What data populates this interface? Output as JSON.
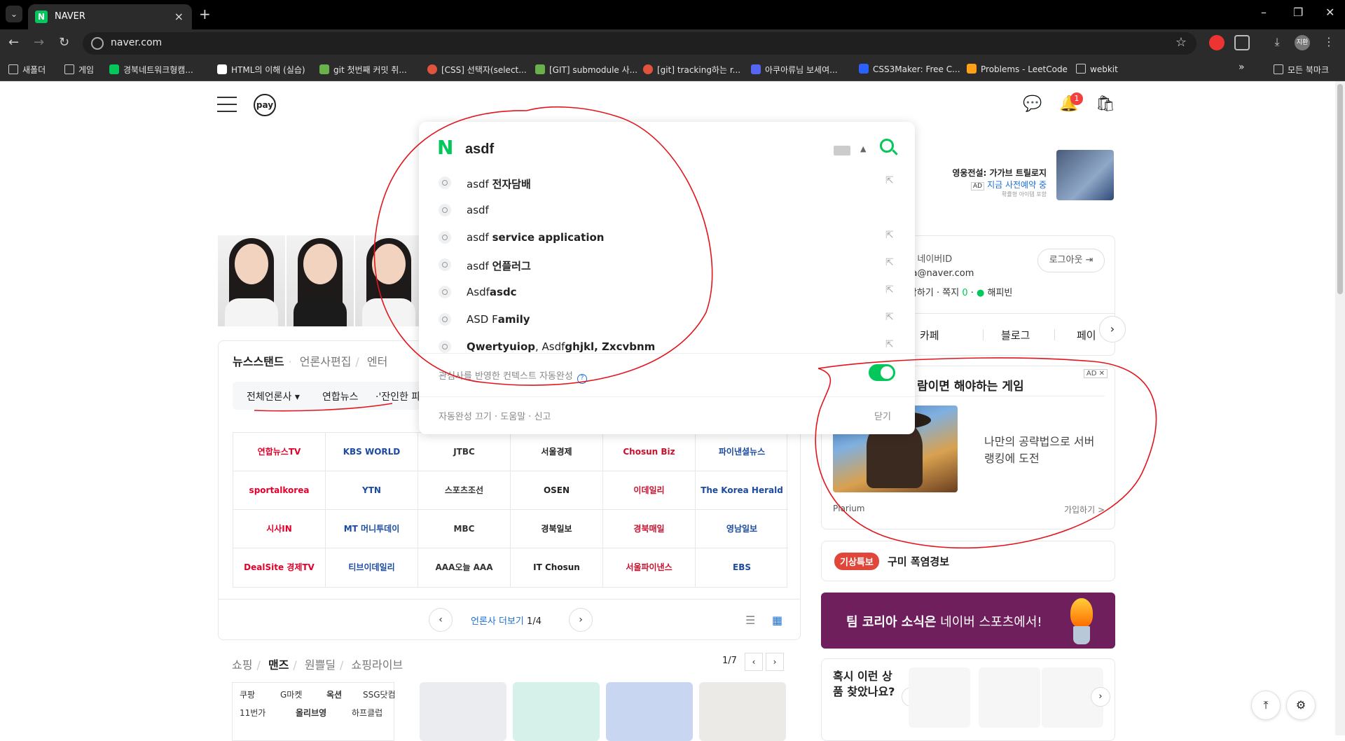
{
  "browser": {
    "tab_title": "NAVER",
    "tab_favicon": "N",
    "url": "naver.com",
    "profile": "지환",
    "bookmarks": [
      "새폴더",
      "게임",
      "경북네트워크형캠...",
      "HTML의 이해 (실습)",
      "git 첫번째 커밋 취...",
      "[CSS] 선택자(select...",
      "[GIT] submodule 사...",
      "[git] tracking하는 r...",
      "아쿠아류님 보세여...",
      "CSS3Maker: Free C...",
      "Problems - LeetCode",
      "webkit"
    ],
    "all_bookmarks": "모든 북마크",
    "more": "»"
  },
  "header": {
    "pay_label": "pay",
    "notification_count": "1"
  },
  "search": {
    "logo": "N",
    "query": "asdf",
    "suggestions": [
      {
        "plain": "asdf ",
        "bold": "전자담배"
      },
      {
        "plain": "asdf",
        "bold": ""
      },
      {
        "plain": "asdf ",
        "bold": "service application"
      },
      {
        "plain": "asdf ",
        "bold": "언플러그"
      },
      {
        "plain": "Asdf",
        "bold": "asdc"
      },
      {
        "plain": "ASD F",
        "bold": "amily"
      },
      {
        "plain": "",
        "bold": "Qwertyuiop",
        "rest": ", Asdf",
        "bold2": "ghjkl, Zxcvbnm"
      }
    ],
    "context_label": "관심사를 반영한 컨텍스트 자동완성",
    "help": "?",
    "footer_links": "자동완성 끄기 · 도움말 · 신고",
    "close": "닫기"
  },
  "banner_ad": {
    "title": "영웅전설: 가가브 트릴로지",
    "ad_tag": "AD",
    "subtitle": "지금 사전예약 중",
    "note": "확률형 아이템 포함"
  },
  "newsstand": {
    "tabs": [
      "뉴스스탠드",
      "언론사편집",
      "엔터"
    ],
    "press_filter": "전체언론사 ▾",
    "press_filter_items": [
      "연합뉴스",
      "·'잔인한 파"
    ],
    "grid": [
      [
        "연합뉴스TV",
        "KBS WORLD",
        "JTBC",
        "서울경제",
        "Chosun Biz",
        "파이낸셜뉴스"
      ],
      [
        "sportalkorea",
        "YTN",
        "스포츠조선",
        "OSEN",
        "이데일리",
        "The Korea Herald"
      ],
      [
        "시사IN",
        "MT 머니투데이",
        "MBC",
        "경북일보",
        "경북매일",
        "영남일보"
      ],
      [
        "DealSite 경제TV",
        "티브이데일리",
        "AAA오늘 AAA",
        "IT Chosun",
        "서울파이낸스",
        "EBS"
      ]
    ],
    "more_label": "언론사 더보기",
    "page": "1/4"
  },
  "shopping": {
    "tabs": [
      "쇼핑",
      "맨즈",
      "원쁠딜",
      "쇼핑라이브"
    ],
    "page": "1/7",
    "malls": [
      "쿠팡",
      "G마켓",
      "옥션",
      "SSG닷컴",
      "11번가",
      "올리브영",
      "하프클럽"
    ]
  },
  "account": {
    "id_suffix": "님 · 네이버ID",
    "email": "nna@naver.com",
    "links": [
      "시작하기",
      "쪽지",
      "0",
      "해피빈"
    ],
    "logout": "로그아웃",
    "services": [
      "카페",
      "블로그",
      "페이"
    ]
  },
  "ad_panel": {
    "badge": "AD ✕",
    "title": "람이면 해야하는 게임",
    "desc": "나만의 공략법으로 서버랭킹에 도전",
    "brand": "Plarium",
    "join": "가입하기 >"
  },
  "weather": {
    "badge": "기상특보",
    "text": "구미 폭염경보"
  },
  "sports": {
    "bold": "팀 코리아 소식은",
    "rest": " 네이버 스포츠에서!"
  },
  "recommend": {
    "title": "혹시 이런 상품 찾았나요?"
  },
  "colors": {
    "naver_green": "#03c75a",
    "annotation_red": "#e3141b"
  }
}
